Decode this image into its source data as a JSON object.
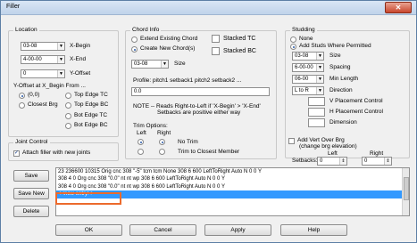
{
  "window": {
    "title": "Filler",
    "close_label": "✕"
  },
  "location": {
    "group_title": "Location",
    "x_begin": {
      "value": "03-08",
      "label": "X-Begin"
    },
    "x_end": {
      "value": "4-00-00",
      "label": "X-End"
    },
    "y_offset": {
      "value": "0",
      "label": "Y-Offset"
    },
    "y_offset_from_label": "Y-Offset at X_Begin From ...",
    "radios": [
      {
        "label": "(0,0)",
        "on": true
      },
      {
        "label": "Top Edge TC",
        "on": false
      },
      {
        "label": "Closest Brg",
        "on": false
      },
      {
        "label": "Top Edge BC",
        "on": false
      },
      {
        "label": "Bot Edge TC",
        "on": false
      },
      {
        "label": "Bot Edge BC",
        "on": false
      }
    ]
  },
  "joint_control": {
    "group_title": "Joint Control",
    "attach_label": "Attach filler with new joints"
  },
  "chord_info": {
    "group_title": "Chord Info",
    "extend_label": "Extend Existing Chord",
    "create_label": "Create New Chord(s)",
    "stacked_tc_label": "Stacked TC",
    "stacked_bc_label": "Stacked BC",
    "size_value": "03-08",
    "size_label": "Size",
    "profile_label": "Profile:  pitch1 setback1 pitch2 setback2 ...",
    "profile_value": "0.0",
    "note_line1": "NOTE -- Reads Right-to-Left if 'X-Begin' > 'X-End'",
    "note_line2": "Setbacks are positive either way",
    "trim_label": "Trim Options:",
    "left_label": "Left",
    "right_label": "Right",
    "no_trim_label": "No Trim",
    "trim_closest_label": "Trim to Closest Member"
  },
  "studding": {
    "group_title": "Studding",
    "none_label": "None",
    "add_studs_label": "Add Studs Where Permitted",
    "size": {
      "value": "03-08",
      "label": "Size"
    },
    "spacing": {
      "value": "6-00-00",
      "label": "Spacing"
    },
    "min_length": {
      "value": "06-00",
      "label": "Min Length"
    },
    "direction": {
      "value": "L to R",
      "label": "Direction"
    },
    "v_placement_label": "V Placement Control",
    "h_placement_label": "H Placement Control",
    "dimension_label": "Dimension",
    "add_vert_label": "Add Vert Over Brg",
    "add_vert_sub": "(change brg elevation)",
    "left_label": "Left",
    "right_label": "Right",
    "setbacks_label": "Setbacks:",
    "setback_left": "0",
    "setback_right": "0"
  },
  "list": {
    "rows": [
      "23 236600 10315 Orig cnc 308 \"-5\" tcm tcm None 308 6 600 LeftToRight Auto N 0 0 Y",
      "308 4 0 Org cnc 308 \"0.0\" nt nt wp 308 6 600 LeftToRight Auto N 0 0 Y",
      "308 4 0 Org cnc 308 \"0.0\" nt nt wp 308 6 600 LeftToRight Auto N 0 0 Y",
      "<<new entry>>"
    ]
  },
  "side_buttons": {
    "save": "Save",
    "save_new": "Save New",
    "delete": "Delete"
  },
  "bottom_buttons": {
    "ok": "OK",
    "cancel": "Cancel",
    "apply": "Apply",
    "help": "Help"
  }
}
